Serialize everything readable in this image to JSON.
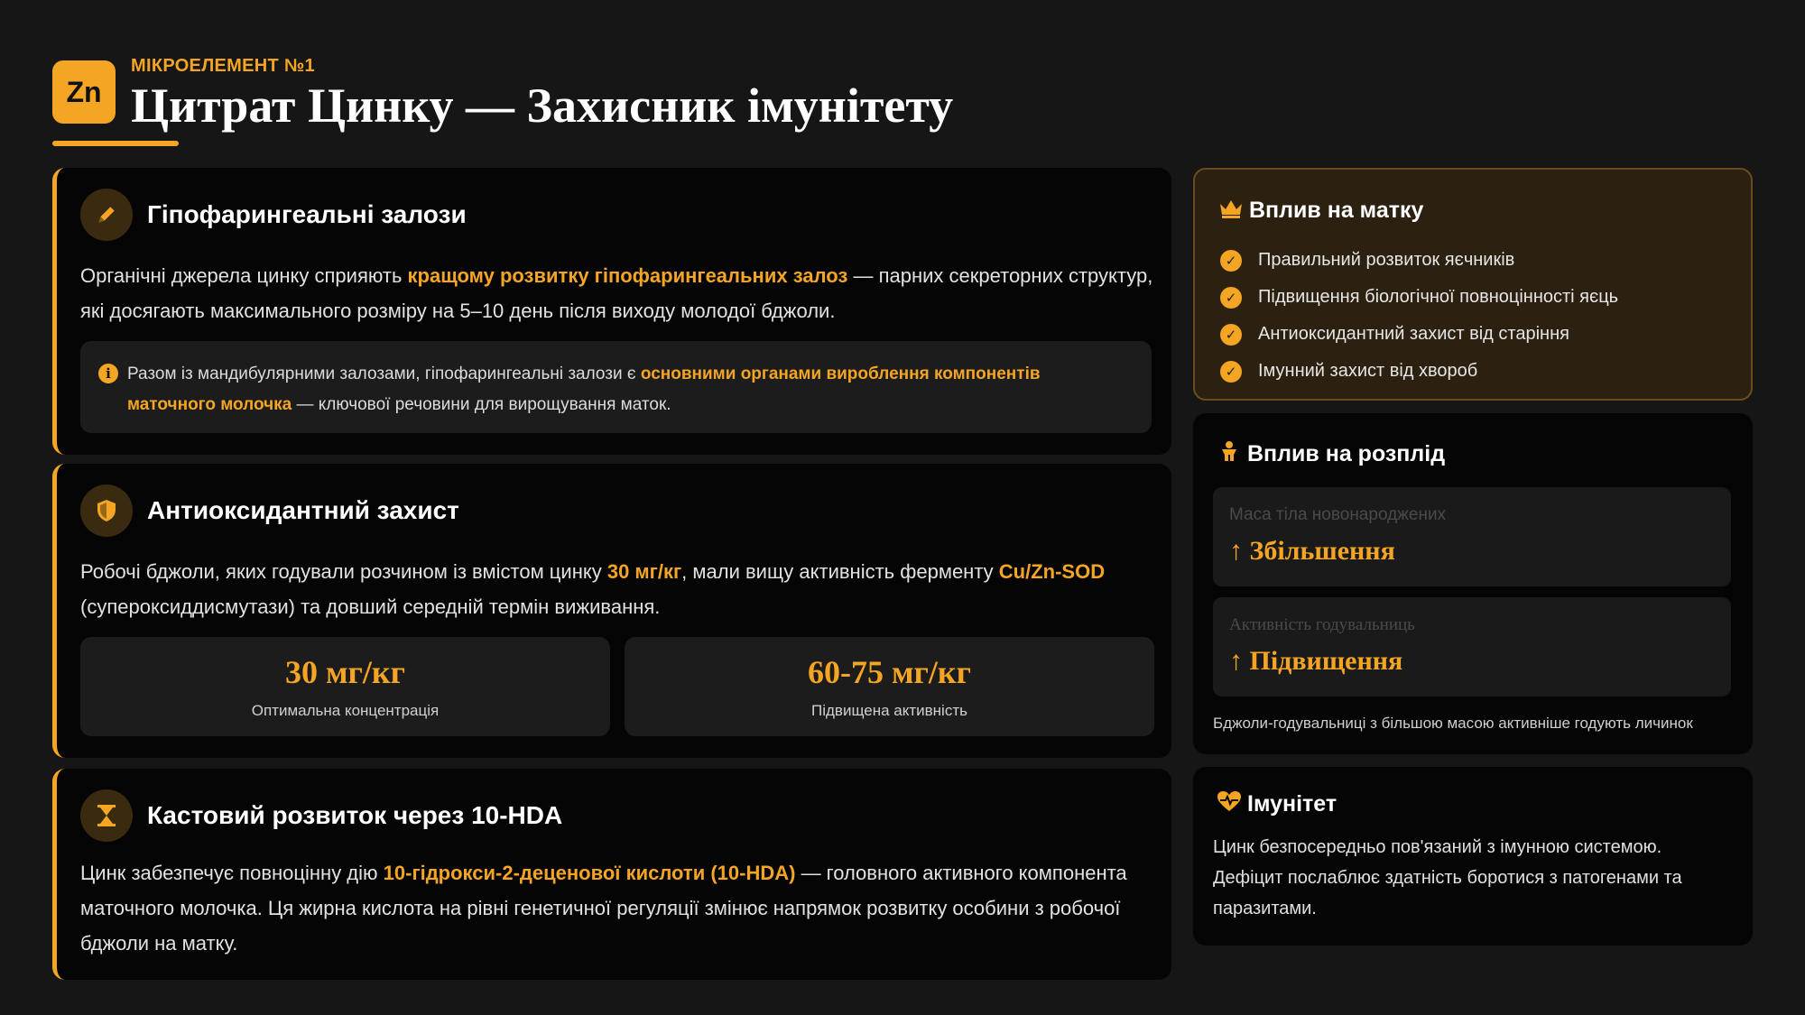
{
  "header": {
    "badge": "Zn",
    "eyebrow": "МІКРОЕЛЕМЕНТ №1",
    "title": "Цитрат Цинку — Захисник імунітету"
  },
  "cards": {
    "glands": {
      "title": "Гіпофарингеальні залози",
      "body_1": "Органічні джерела цинку сприяють ",
      "body_hl": "кращому розвитку гіпофарингеальних залоз",
      "body_2": " — парних секреторних структур, які досягають максимального розміру на 5–10 день після виходу молодої бджоли.",
      "note_icon": "info-icon",
      "note_1": "Разом із мандибулярними залозами, гіпофарингеальні залози є ",
      "note_hl": "основними органами вироблення компонентів маточного молочка",
      "note_2": " — ключової речовини для вирощування маток."
    },
    "antioxidant": {
      "title": "Антиоксидантний захист",
      "body_1": "Робочі бджоли, яких годували розчином із вмістом цинку ",
      "body_hl1": "30 мг/кг",
      "body_2": ", мали вищу активність ферменту ",
      "body_hl2": "Cu/Zn-SOD",
      "body_3": " (супероксиддисмутази) та довший середній термін виживання.",
      "stats": [
        {
          "value": "30 мг/кг",
          "label": "Оптимальна концентрація"
        },
        {
          "value": "60-75 мг/кг",
          "label": "Підвищена активність"
        }
      ]
    },
    "caste": {
      "title": "Кастовий розвиток через 10-HDA",
      "body_1": "Цинк забезпечує повноцінну дію ",
      "body_hl": "10-гідрокси-2-деценової кислоти (10-HDA)",
      "body_2": " — головного активного компонента маточного молочка. Ця жирна кислота на рівні генетичної регуляції змінює напрямок розвитку особини з робочої бджоли на матку."
    }
  },
  "panels": {
    "queen": {
      "title": "Вплив на матку",
      "items": [
        "Правильний розвиток яєчників",
        "Підвищення біологічної повноцінності яєць",
        "Антиоксидантний захист від старіння",
        "Імунний захист від хвороб"
      ]
    },
    "brood": {
      "title": "Вплив на розплід",
      "metrics": [
        {
          "label": "Маса тіла новонароджених",
          "value": "↑ Збільшення"
        },
        {
          "label": "Активність годувальниць",
          "value": "↑ Підвищення"
        }
      ],
      "footnote": "Бджоли-годувальниці з більшою масою активніше годують личинок"
    },
    "immunity": {
      "title": "Імунітет",
      "text": "Цинк безпосередньо пов'язаний з імунною системою. Дефіцит послаблює здатність боротися з патогенами та паразитами."
    }
  },
  "colors": {
    "accent": "#f5a524",
    "background": "#161616",
    "card": "#050505"
  }
}
